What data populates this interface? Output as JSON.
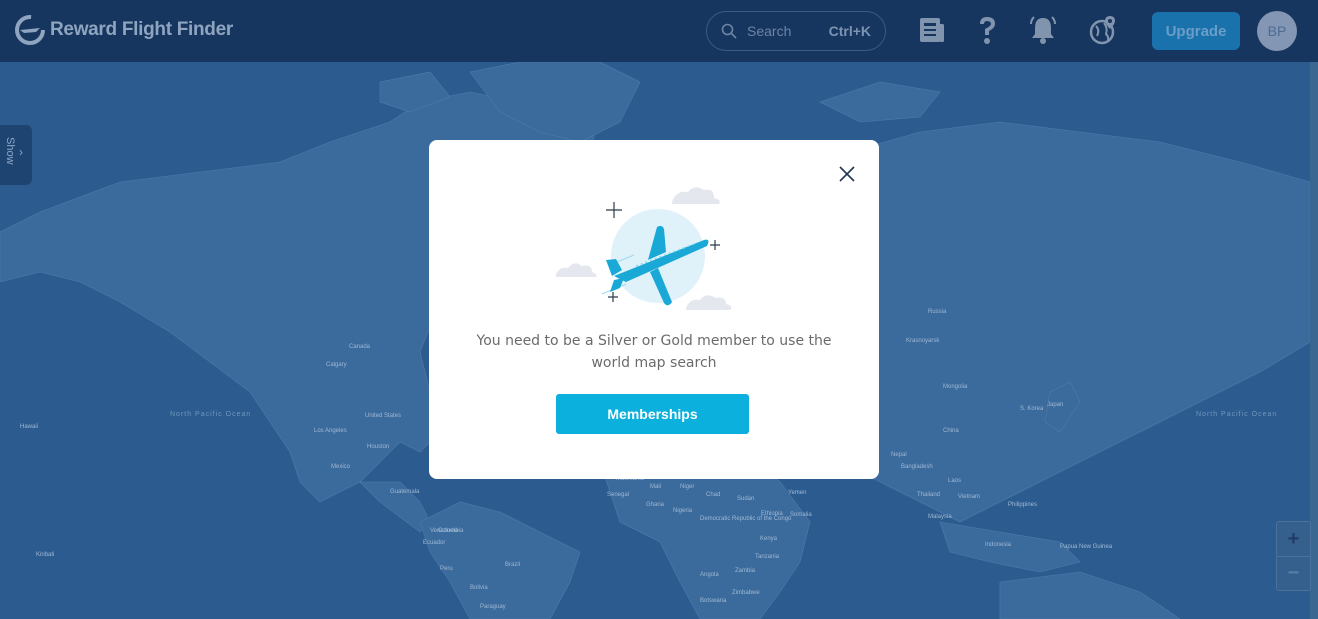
{
  "header": {
    "brand": "Reward Flight Finder",
    "search_placeholder": "Search",
    "search_shortcut": "Ctrl+K",
    "upgrade_label": "Upgrade",
    "avatar_initials": "BP"
  },
  "sidebar_toggle": {
    "label": "Show"
  },
  "map": {
    "labels": {
      "canada": "Canada",
      "calgary": "Calgary",
      "united_states": "United States",
      "houston": "Houston",
      "mexico": "Mexico",
      "los_angeles": "Los Angeles",
      "colombia": "Colombia",
      "peru": "Peru",
      "brazil": "Brazil",
      "bolivia": "Bolivia",
      "paraguay": "Paraguay",
      "ecuador": "Ecuador",
      "venezuela": "Venezuela",
      "guatemala": "Guatemala",
      "russia": "Russia",
      "krasnoyarsk": "Krasnoyarsk",
      "mongolia": "Mongolia",
      "china": "China",
      "japan": "Japan",
      "korea": "S. Korea",
      "nepal": "Nepal",
      "bangladesh": "Bangladesh",
      "laos": "Laos",
      "vietnam": "Vietnam",
      "thailand": "Thailand",
      "philippines": "Philippines",
      "malaysia": "Malaysia",
      "indonesia": "Indonesia",
      "papua": "Papua New Guinea",
      "senegal": "Senegal",
      "mali": "Mali",
      "niger": "Niger",
      "chad": "Chad",
      "sudan": "Sudan",
      "nigeria": "Nigeria",
      "ethiopia": "Ethiopia",
      "somalia": "Somalia",
      "kenya": "Kenya",
      "drc": "Democratic Republic of the Congo",
      "tanzania": "Tanzania",
      "angola": "Angola",
      "zambia": "Zambia",
      "zimbabwe": "Zimbabwe",
      "botswana": "Botswana",
      "yemen": "Yemen",
      "ghana": "Ghana",
      "mauritania": "Mauritania",
      "north_pacific_ocean": "North Pacific Ocean",
      "north_pacific_ocean_2": "North Pacific Ocean",
      "hawaii": "Hawaii",
      "kiribati": "Kiribati"
    },
    "zoom_in": "+",
    "zoom_out": "−"
  },
  "modal": {
    "message": "You need to be a Silver or Gold member to use the world map search",
    "cta_label": "Memberships"
  },
  "colors": {
    "header_bg": "#16355f",
    "map_bg": "#2c5c8f",
    "land": "#3b6a9c",
    "cta": "#0bb0dd",
    "plane": "#1aa9d6"
  }
}
